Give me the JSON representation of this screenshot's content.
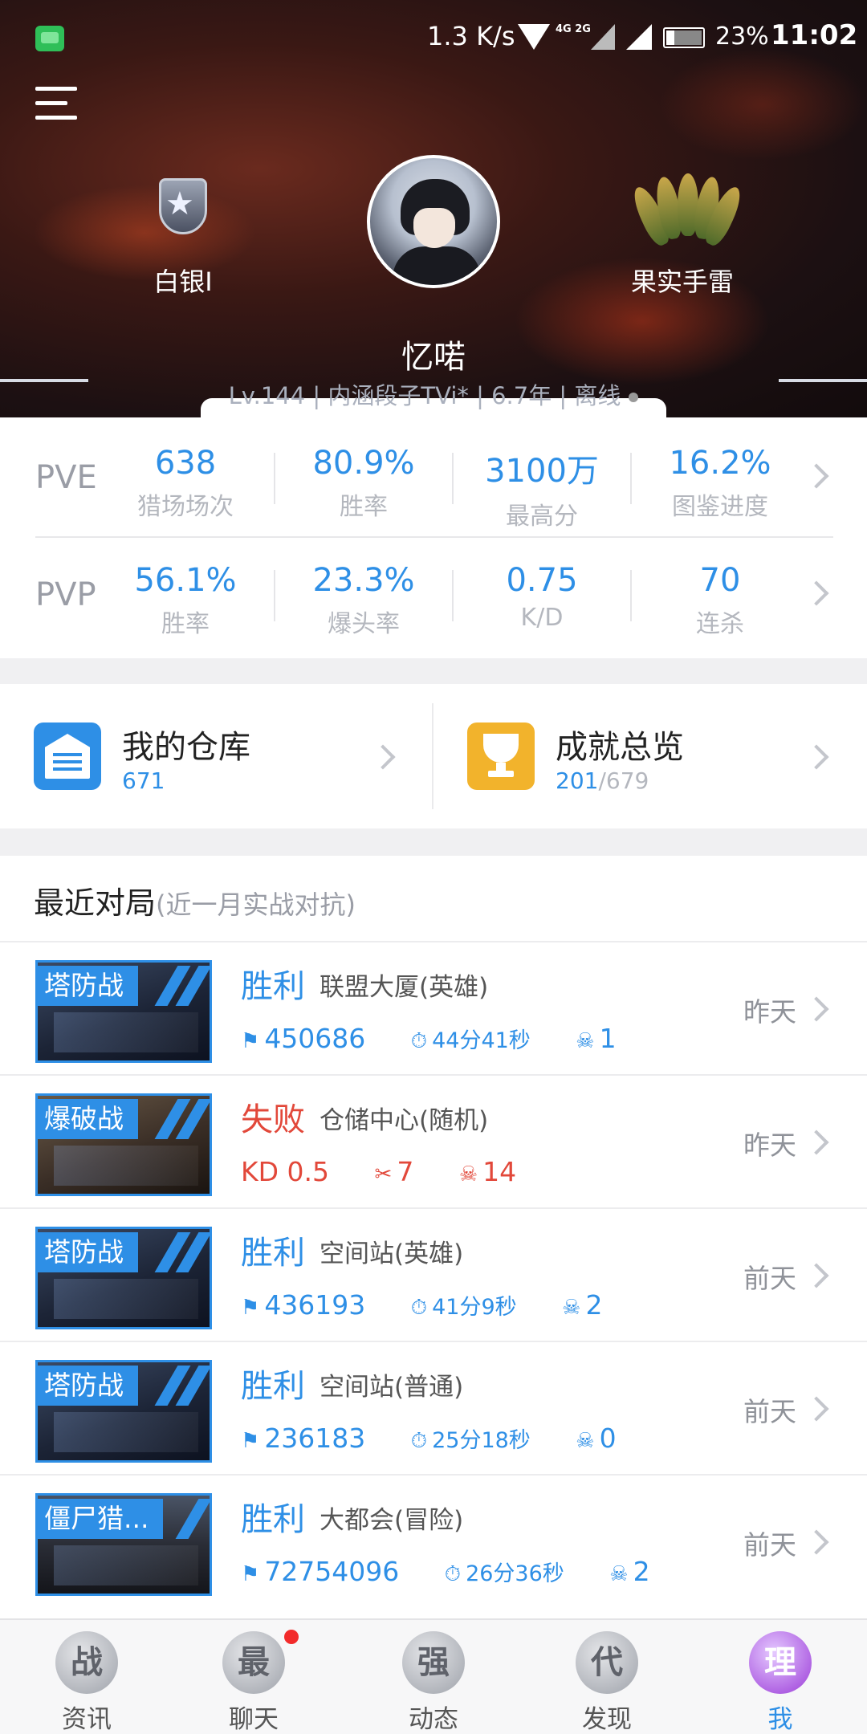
{
  "status_bar": {
    "net_speed": "1.3 K/s",
    "lte": "4G 2G",
    "battery": "23%",
    "time": "11:02"
  },
  "profile": {
    "rank_label": "白银I",
    "weapon_label": "果实手雷",
    "nickname": "忆喏",
    "meta": "Lv.144 | 内涵段子TVi* | 6.7年 | 离线"
  },
  "pve": {
    "mode": "PVE",
    "stats": [
      {
        "value": "638",
        "label": "猎场场次"
      },
      {
        "value": "80.9%",
        "label": "胜率"
      },
      {
        "value": "3100万",
        "label": "最高分"
      },
      {
        "value": "16.2%",
        "label": "图鉴进度"
      }
    ]
  },
  "pvp": {
    "mode": "PVP",
    "stats": [
      {
        "value": "56.1%",
        "label": "胜率"
      },
      {
        "value": "23.3%",
        "label": "爆头率"
      },
      {
        "value": "0.75",
        "label": "K/D"
      },
      {
        "value": "70",
        "label": "连杀"
      }
    ]
  },
  "quick": {
    "warehouse": {
      "title": "我的仓库",
      "count": "671",
      "color": "#2e8fe6"
    },
    "achievement": {
      "title": "成就总览",
      "count": "201",
      "total": "/679",
      "color": "#f2b32c"
    }
  },
  "recent": {
    "title": "最近对局",
    "subtitle": "(近一月实战对抗)",
    "matches": [
      {
        "tag": "塔防战",
        "result": "胜利",
        "map": "联盟大厦(英雄)",
        "score": "450686",
        "time_min": "44",
        "time_sec": "41",
        "deaths": "1",
        "when": "昨天"
      },
      {
        "tag": "爆破战",
        "result": "失败",
        "map": "仓储中心(随机)",
        "kd": "KD 0.5",
        "kills": "7",
        "deaths": "14",
        "when": "昨天"
      },
      {
        "tag": "塔防战",
        "result": "胜利",
        "map": "空间站(英雄)",
        "score": "436193",
        "time_min": "41",
        "time_sec": "9",
        "deaths": "2",
        "when": "前天"
      },
      {
        "tag": "塔防战",
        "result": "胜利",
        "map": "空间站(普通)",
        "score": "236183",
        "time_min": "25",
        "time_sec": "18",
        "deaths": "0",
        "when": "前天"
      },
      {
        "tag": "僵尸猎...",
        "result": "胜利",
        "map": "大都会(冒险)",
        "score": "72754096",
        "time_min": "26",
        "time_sec": "36",
        "deaths": "2",
        "when": "前天"
      }
    ],
    "min_unit": "分",
    "sec_unit": "秒"
  },
  "tabs": [
    {
      "glyph": "战",
      "label": "资讯"
    },
    {
      "glyph": "最",
      "label": "聊天"
    },
    {
      "glyph": "强",
      "label": "动态"
    },
    {
      "glyph": "代",
      "label": "发现"
    },
    {
      "glyph": "理",
      "label": "我"
    }
  ]
}
